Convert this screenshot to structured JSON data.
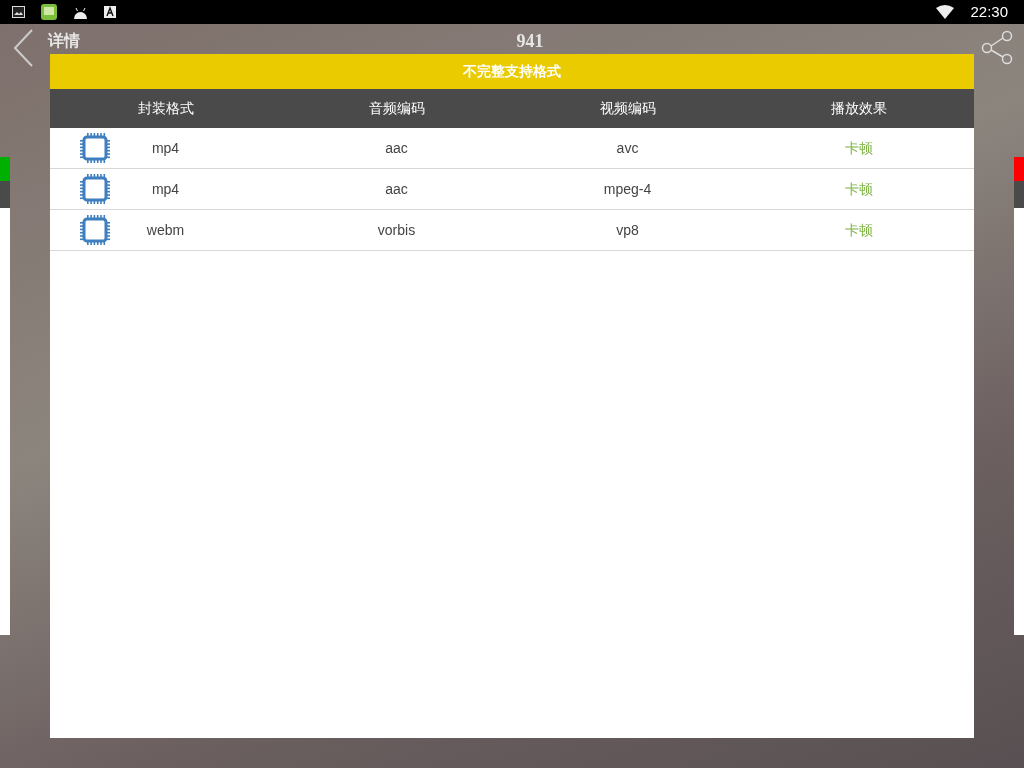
{
  "status_bar": {
    "time": "22:30"
  },
  "header": {
    "title": "详情",
    "number": "941"
  },
  "dialog": {
    "title": "不完整支持格式",
    "columns": [
      "封装格式",
      "音频编码",
      "视频编码",
      "播放效果"
    ],
    "rows": [
      {
        "container": "mp4",
        "audio": "aac",
        "video": "avc",
        "effect": "卡顿"
      },
      {
        "container": "mp4",
        "audio": "aac",
        "video": "mpeg-4",
        "effect": "卡顿"
      },
      {
        "container": "webm",
        "audio": "vorbis",
        "video": "vp8",
        "effect": "卡顿"
      }
    ]
  }
}
